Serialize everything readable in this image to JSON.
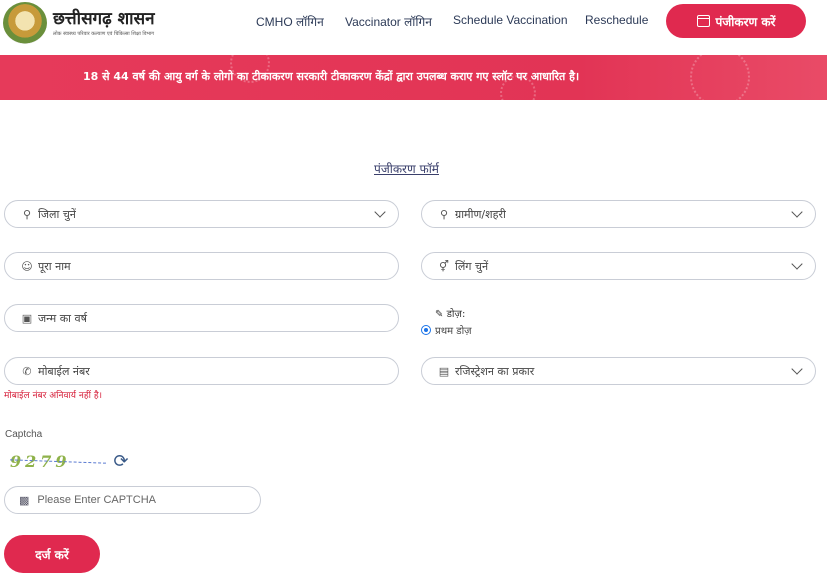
{
  "header": {
    "logo_title": "छत्तीसगढ़ शासन",
    "logo_subtitle": "लोक स्वास्थ्य परिवार कल्याण एवं चिकित्सा शिक्षा विभाग",
    "nav": [
      "CMHO लॉगिन",
      "Vaccinator लॉगिन",
      "Schedule Vaccination",
      "Reschedule"
    ],
    "register_label": "पंजीकरण करें",
    "register_icon": "calendar-icon",
    "accent_color": "#e0294f"
  },
  "banner": {
    "text": "18 से 44 वर्ष की आयु वर्ग के लोगो का टीकाकरण सरकारी टीकाकरण केंद्रों द्वारा उपलब्ध कराए गए स्लॉट पर आधारित है।"
  },
  "form": {
    "title": "पंजीकरण फॉर्म",
    "district": {
      "label": "जिला चुनें",
      "icon": "map-pin-icon"
    },
    "area": {
      "label": "ग्रामीण/शहरी",
      "icon": "map-pin-icon"
    },
    "name": {
      "placeholder": "पूरा नाम",
      "icon": "user-icon"
    },
    "gender": {
      "label": "लिंग चुनें",
      "icon": "gender-icon"
    },
    "birth_year": {
      "placeholder": "जन्म का वर्ष",
      "icon": "id-card-icon"
    },
    "dose": {
      "label": "डोज़:",
      "option": "प्रथम डोज़",
      "selected": true
    },
    "mobile": {
      "placeholder": "मोबाईल नंबर",
      "icon": "phone-icon",
      "note": "मोबाईल नंबर अनिवार्य नहीं है।"
    },
    "registration_type": {
      "label": "रजिस्ट्रेशन का प्रकार",
      "icon": "document-icon"
    },
    "captcha": {
      "label": "Captcha",
      "image_text": "9279",
      "placeholder": "Please Enter CAPTCHA",
      "icon": "puzzle-icon",
      "refresh_icon": "refresh-icon"
    },
    "submit_label": "दर्ज करें"
  }
}
